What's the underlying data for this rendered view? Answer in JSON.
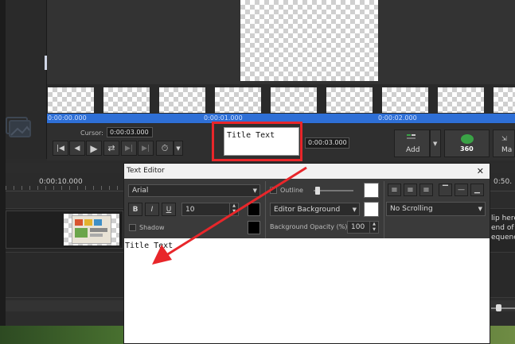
{
  "preview": {
    "ruler_labels": [
      "0:00:00.000",
      "0:00:01.000",
      "0:00:02.000"
    ]
  },
  "controls": {
    "cursor_label": "Cursor:",
    "cursor_value": "0:00:03.000",
    "duration_value": "0:00:03.000",
    "title_preview_text": "Title Text"
  },
  "toolbar": {
    "add_label": "Add",
    "badge_360": "360",
    "max_label": "Ma"
  },
  "timeline": {
    "ruler_label_left": "0:00:10.000",
    "ruler_label_right": "0:50.",
    "clip_hint_lines": [
      "lip here",
      "end of",
      "equenc"
    ]
  },
  "text_editor": {
    "title": "Text Editor",
    "close_glyph": "✕",
    "font_name": "Arial",
    "bold_label": "B",
    "italic_label": "I",
    "underline_label": "U",
    "font_size": "10",
    "shadow_label": "Shadow",
    "outline_label": "Outline",
    "background_select": "Editor Background",
    "bg_opacity_label": "Background Opacity (%):",
    "bg_opacity_value": "100",
    "scrolling_select": "No Scrolling",
    "content_text": "Title Text"
  },
  "colors": {
    "annotation_red": "#e8262a",
    "accent_blue": "#2e6fd6",
    "toolbar_green": "#3aa346"
  }
}
